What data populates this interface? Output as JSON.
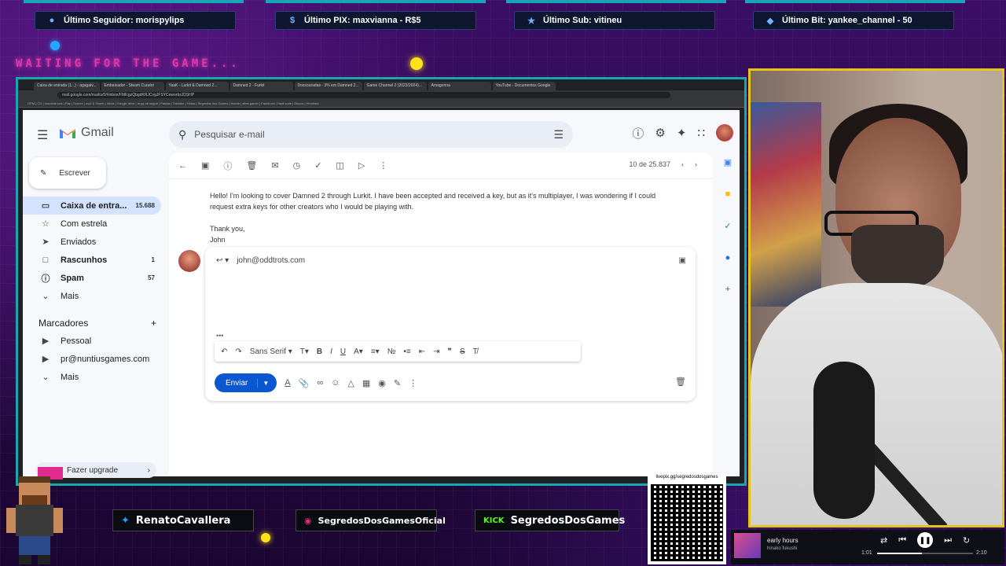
{
  "overlay": {
    "alerts": [
      {
        "icon": "user-icon",
        "text": "Último Seguidor: morispylips"
      },
      {
        "icon": "dollar-icon",
        "text": "Último PIX: maxvianna - R$5"
      },
      {
        "icon": "star-icon",
        "text": "Último Sub: vitineu"
      },
      {
        "icon": "diamond-icon",
        "text": "Último Bit: yankee_channel - 50"
      }
    ],
    "waiting": "WAITING FOR THE GAME...",
    "socials": [
      {
        "icon": "twitter-icon",
        "text": "RenatoCavallera"
      },
      {
        "icon": "instagram-icon",
        "text": "SegredosDosGamesOficial"
      },
      {
        "icon": "kick-icon",
        "text": "SegredosDosGames",
        "badge": "KICK"
      }
    ],
    "qr_label": "livepix.gg/segredosdosgames",
    "player": {
      "title": "early hours",
      "artist": "hinako fukushi",
      "elapsed": "1:01",
      "duration": "2:10",
      "progress": 0.47
    }
  },
  "browser": {
    "tabs": [
      "Caixa de entrada (1...) - agagalv...",
      "Embaixador - Steam Curator",
      "YaaK - Lurkit & Damned 2...",
      "Damned 2 - Furkit",
      "Dossouradas - 3% em Damned 2...",
      "Game Channel 2 (2023/2024)...",
      "Amagonna",
      "YouTube - Documentos Google"
    ],
    "url": "mail.google.com/mail/u/0/#inbox/FMfcgzQbgdKRJCvgJFSYCeworbsJDSHP",
    "bookmarks": "GPM  |  CG  |  moral/arrows  |  Pay  |  Screen  |  uw2 & Sweet  |  Ideas  |  Google drive  |  la pg de seguir  |  Pastas  |  Tradutor  |  Notas  |  Segredos dos Games  |  Hamle  |  sites gamer  |  Facebook  |  Hadi sode  |  Discos  |  Hemilota"
  },
  "gmail": {
    "brand": "Gmail",
    "search_placeholder": "Pesquisar e-mail",
    "compose": "Escrever",
    "nav": [
      {
        "icon": "inbox-icon",
        "label": "Caixa de entra...",
        "count": "15.688",
        "active": true,
        "bold": true
      },
      {
        "icon": "star-icon",
        "label": "Com estrela",
        "count": "",
        "active": false,
        "bold": false
      },
      {
        "icon": "send-icon",
        "label": "Enviados",
        "count": "",
        "active": false,
        "bold": false
      },
      {
        "icon": "draft-icon",
        "label": "Rascunhos",
        "count": "1",
        "active": false,
        "bold": true
      },
      {
        "icon": "spam-icon",
        "label": "Spam",
        "count": "57",
        "active": false,
        "bold": true
      },
      {
        "icon": "chevron-down-icon",
        "label": "Mais",
        "count": "",
        "active": false,
        "bold": false
      }
    ],
    "labels_title": "Marcadores",
    "labels": [
      {
        "icon": "label-icon",
        "label": "Pessoal"
      },
      {
        "icon": "label-icon",
        "label": "pr@nuntiusgames.com"
      },
      {
        "icon": "chevron-down-icon",
        "label": "Mais"
      }
    ],
    "upgrade": "Fazer upgrade",
    "pager": "10 de 25.837",
    "message": {
      "paragraph": "Hello! I'm looking to cover Damned 2 through Lurkit. I have been accepted and received a key, but as it's multiplayer, I was wondering if I could request extra keys for other creators who I would be playing with.",
      "thanks": "Thank you,",
      "signature": "John"
    },
    "reply": {
      "to": "john@oddtrots.com",
      "font": "Sans Serif",
      "send": "Enviar"
    }
  }
}
